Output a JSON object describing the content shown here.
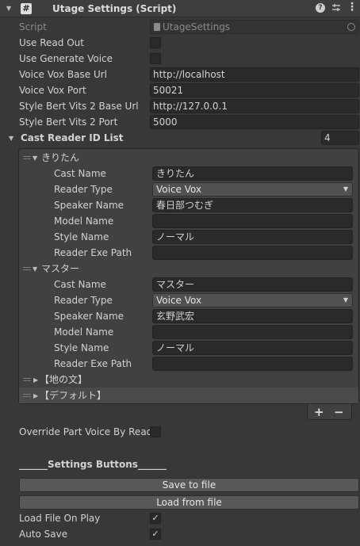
{
  "header": {
    "title": "Utage Settings (Script)",
    "script_icon_glyph": "#"
  },
  "script_row": {
    "label": "Script",
    "value": "UtageSettings"
  },
  "fields": {
    "use_read_out": {
      "label": "Use Read Out",
      "checked": false
    },
    "use_generate_voice": {
      "label": "Use Generate Voice",
      "checked": false
    },
    "voice_vox_base_url": {
      "label": "Voice Vox Base Url",
      "value": "http://localhost"
    },
    "voice_vox_port": {
      "label": "Voice Vox Port",
      "value": "50021"
    },
    "style_bert_vits2_base_url": {
      "label": "Style Bert Vits 2 Base Url",
      "value": "http://127.0.0.1"
    },
    "style_bert_vits2_port": {
      "label": "Style Bert Vits 2 Port",
      "value": "5000"
    }
  },
  "cast_list": {
    "label": "Cast Reader ID List",
    "count": "4",
    "elements": [
      {
        "name": "きりたん",
        "expanded": true,
        "fields": [
          {
            "label": "Cast Name",
            "value": "きりたん",
            "type": "text"
          },
          {
            "label": "Reader Type",
            "value": "Voice Vox",
            "type": "dropdown"
          },
          {
            "label": "Speaker Name",
            "value": "春日部つむぎ",
            "type": "text"
          },
          {
            "label": "Model Name",
            "value": "",
            "type": "text"
          },
          {
            "label": "Style Name",
            "value": "ノーマル",
            "type": "text"
          },
          {
            "label": "Reader Exe Path",
            "value": "",
            "type": "text"
          }
        ]
      },
      {
        "name": "マスター",
        "expanded": true,
        "fields": [
          {
            "label": "Cast Name",
            "value": "マスター",
            "type": "text"
          },
          {
            "label": "Reader Type",
            "value": "Voice Vox",
            "type": "dropdown"
          },
          {
            "label": "Speaker Name",
            "value": "玄野武宏",
            "type": "text"
          },
          {
            "label": "Model Name",
            "value": "",
            "type": "text"
          },
          {
            "label": "Style Name",
            "value": "ノーマル",
            "type": "text"
          },
          {
            "label": "Reader Exe Path",
            "value": "",
            "type": "text"
          }
        ]
      },
      {
        "name": "【地の文】",
        "expanded": false
      },
      {
        "name": "【デフォルト】",
        "expanded": false
      }
    ],
    "add_label": "+",
    "remove_label": "−"
  },
  "override_part_voice": {
    "label": "Override Part Voice By Read",
    "checked": false
  },
  "settings_buttons_heading": "______Settings Buttons______",
  "buttons": {
    "save": "Save to file",
    "load": "Load from file"
  },
  "load_file_on_play": {
    "label": "Load File On Play",
    "checked": true
  },
  "auto_save": {
    "label": "Auto Save",
    "checked": true
  },
  "colors": {
    "background": "#383838",
    "header": "#3e3e3e",
    "field": "#2a2a2a",
    "button": "#585858"
  },
  "icons": [
    "foldout-arrow-icon",
    "script-icon",
    "help-icon",
    "presets-icon",
    "menu-icon",
    "object-picker-icon",
    "reorder-grip-icon",
    "dropdown-arrow-icon",
    "checkmark-icon"
  ]
}
